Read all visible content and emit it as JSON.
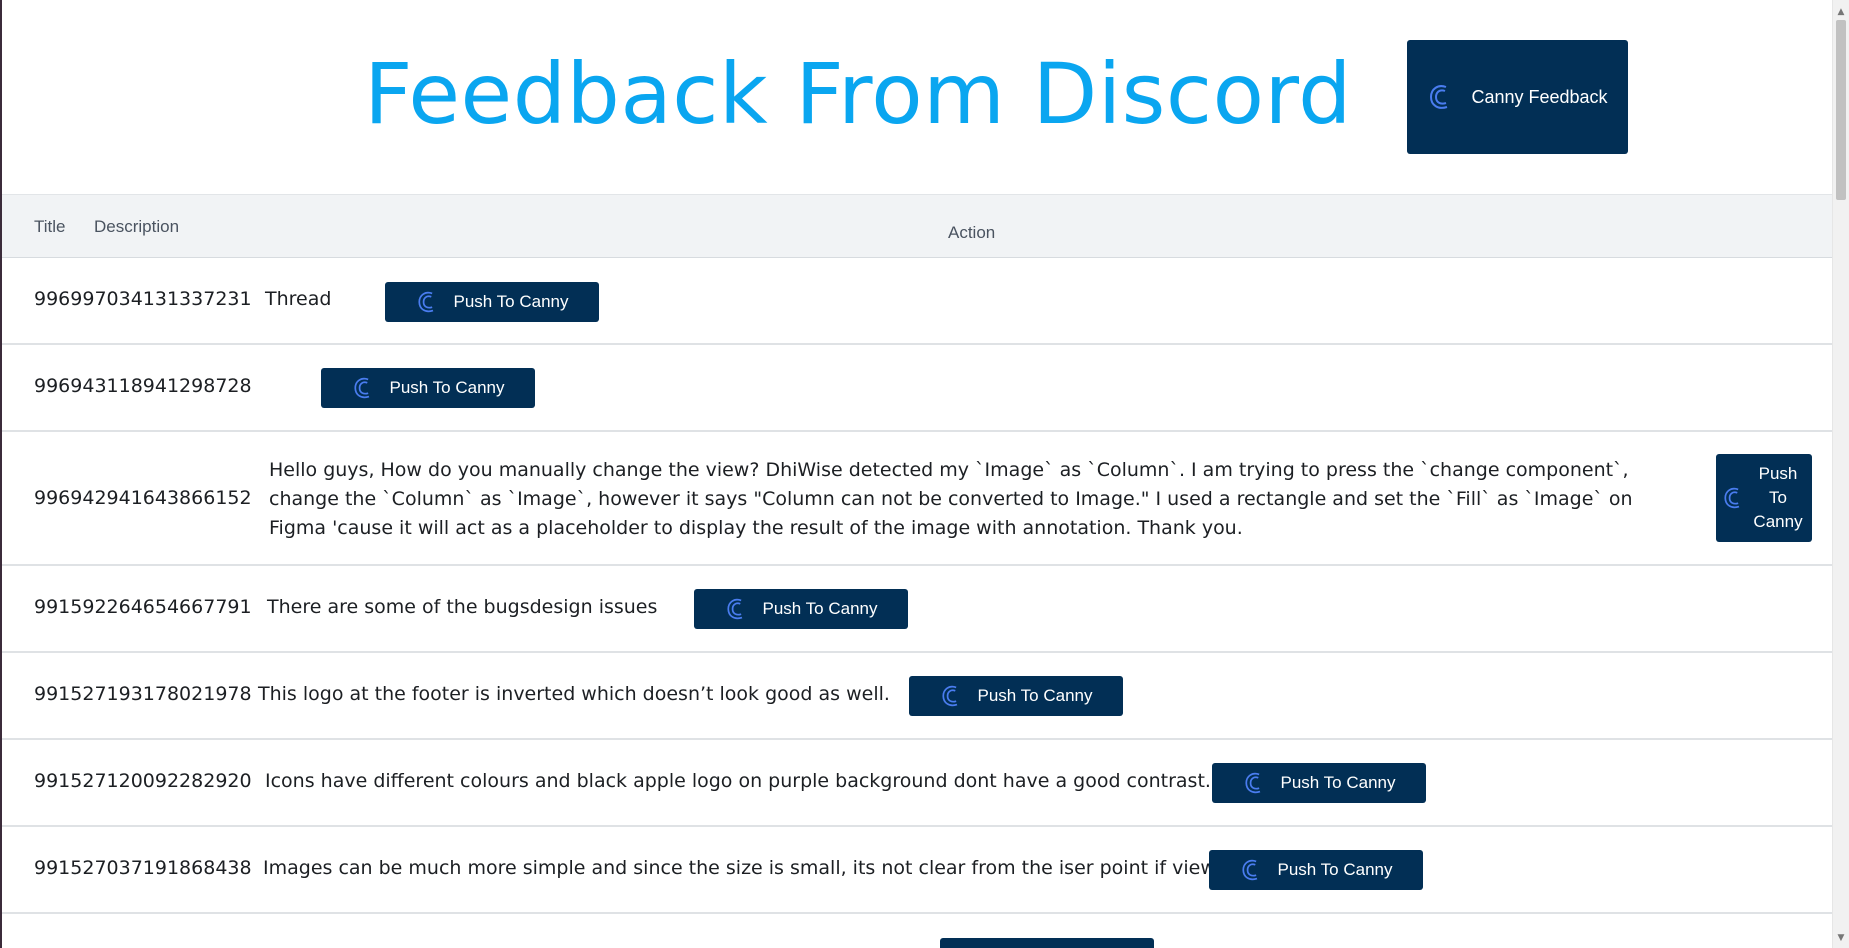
{
  "header": {
    "title": "Feedback From Discord",
    "canny_button_label": "Canny Feedback"
  },
  "table": {
    "columns": {
      "title": "Title",
      "description": "Description",
      "action": "Action"
    },
    "rows": [
      {
        "id": "996997034131337231",
        "description": "Thread",
        "button": "Push To Canny"
      },
      {
        "id": "996943118941298728",
        "description": "",
        "button": "Push To Canny"
      },
      {
        "id": "996942941643866152",
        "description": "Hello guys, How do you manually change the view? DhiWise detected my `Image` as `Column`. I am trying to press the `change component`, change the `Column` as `Image`, however it says \"Column can not be converted to Image.\" I used a rectangle and set the `Fill` as `Image` on Figma 'cause it will act as a placeholder to display the result of the image with annotation. Thank you.",
        "button": "Push To Canny"
      },
      {
        "id": "991592264654667791",
        "description": "There are some of the bugsdesign issues",
        "button": "Push To Canny"
      },
      {
        "id": "991527193178021978",
        "description": "This logo at the footer is inverted which doesn’t look good as well.",
        "button": "Push To Canny"
      },
      {
        "id": "991527120092282920",
        "description": "Icons have different colours and black apple logo on purple background dont have a good contrast.",
        "button": "Push To Canny"
      },
      {
        "id": "991527037191868438",
        "description": "Images can be much more simple and since the size is small, its not clear from the iser point if view",
        "button": "Push To Canny"
      }
    ]
  },
  "colors": {
    "title": "#0aa6f0",
    "button_bg": "#022f55",
    "icon": "#4a7df0",
    "header_bg": "#f1f3f5"
  },
  "icons": {
    "canny": "canny-logo-icon"
  }
}
